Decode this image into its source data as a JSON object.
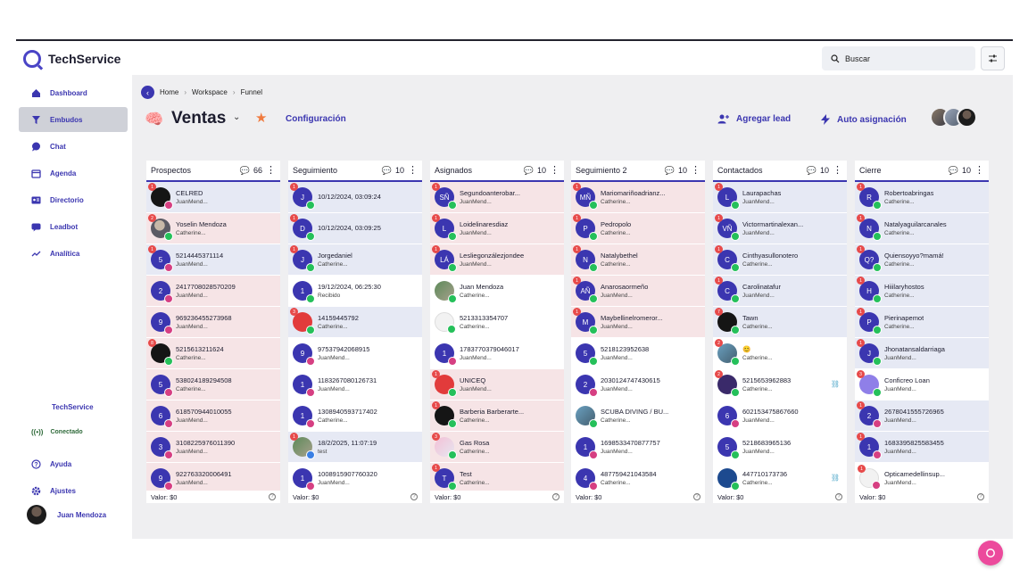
{
  "app": {
    "name": "TechService"
  },
  "search": {
    "placeholder": "Buscar"
  },
  "sidebar": {
    "items": [
      {
        "label": "Dashboard",
        "icon": "home-icon"
      },
      {
        "label": "Embudos",
        "icon": "funnel-icon",
        "active": true
      },
      {
        "label": "Chat",
        "icon": "chat-icon"
      },
      {
        "label": "Agenda",
        "icon": "calendar-icon"
      },
      {
        "label": "Directorio",
        "icon": "contacts-icon"
      },
      {
        "label": "Leadbot",
        "icon": "bot-icon"
      },
      {
        "label": "Analítica",
        "icon": "trend-icon"
      }
    ],
    "brand": "TechService",
    "status": "Conectado",
    "help": "Ayuda",
    "settings": "Ajustes",
    "user": "Juan Mendoza"
  },
  "breadcrumb": [
    "Home",
    "Workspace",
    "Funnel"
  ],
  "header": {
    "title": "Ventas",
    "config": "Configuración",
    "add_lead": "Agregar lead",
    "auto_assign": "Auto asignación"
  },
  "colors": {
    "accent": "#3b36b0",
    "star": "#f07a3e",
    "fab": "#ec4a9c"
  },
  "columns": [
    {
      "title": "Prospectos",
      "count": "66",
      "footer": "Valor:  $0",
      "cards": [
        {
          "name": "CELRED",
          "sub": "JuanMend...",
          "av": "",
          "avc": "black",
          "badge": "1",
          "chan": "ig",
          "bg": "blue"
        },
        {
          "name": "Yoselin Mendoza",
          "sub": "Catherine...",
          "av": "",
          "avc": "photo",
          "badge": "2",
          "chan": "wa",
          "bg": "red"
        },
        {
          "name": "5214445371114",
          "sub": "JuanMend...",
          "av": "5",
          "avc": "",
          "badge": "1",
          "chan": "ig",
          "bg": "blue"
        },
        {
          "name": "2417708028570209",
          "sub": "JuanMend...",
          "av": "2",
          "avc": "",
          "badge": "",
          "chan": "ig",
          "bg": "red"
        },
        {
          "name": "969236455273968",
          "sub": "JuanMend...",
          "av": "9",
          "avc": "",
          "badge": "",
          "chan": "ig",
          "bg": "red"
        },
        {
          "name": "5215613211624",
          "sub": "Catherine...",
          "av": "",
          "avc": "black",
          "badge": "8",
          "chan": "wa",
          "bg": "red"
        },
        {
          "name": "538024189294508",
          "sub": "Catherine...",
          "av": "5",
          "avc": "",
          "badge": "",
          "chan": "ig",
          "bg": "red"
        },
        {
          "name": "618570944010055",
          "sub": "JuanMend...",
          "av": "6",
          "avc": "",
          "badge": "",
          "chan": "ig",
          "bg": "red"
        },
        {
          "name": "3108225976011390",
          "sub": "JuanMend...",
          "av": "3",
          "avc": "",
          "badge": "",
          "chan": "ig",
          "bg": "red"
        },
        {
          "name": "922763320006491",
          "sub": "JuanMend...",
          "av": "9",
          "avc": "",
          "badge": "",
          "chan": "ig",
          "bg": "red"
        }
      ]
    },
    {
      "title": "Seguimiento",
      "count": "10",
      "footer": "Valor:  $0",
      "cards": [
        {
          "name": "10/12/2024, 03:09:24",
          "sub": "",
          "av": "J",
          "avc": "",
          "badge": "1",
          "chan": "wa",
          "bg": "blue"
        },
        {
          "name": "10/12/2024, 03:09:25",
          "sub": "",
          "av": "D",
          "avc": "",
          "badge": "1",
          "chan": "wa",
          "bg": "blue"
        },
        {
          "name": "Jorgedaniel",
          "sub": "Catherine...",
          "av": "J",
          "avc": "",
          "badge": "1",
          "chan": "wa",
          "bg": "blue"
        },
        {
          "name": "19/12/2024, 06:25:30",
          "sub": "Recibido",
          "av": "1",
          "avc": "",
          "badge": "",
          "chan": "wa",
          "bg": "white"
        },
        {
          "name": "14159445792",
          "sub": "Catherine...",
          "av": "",
          "avc": "red",
          "badge": "3",
          "chan": "wa",
          "bg": "blue"
        },
        {
          "name": "97537942068915",
          "sub": "JuanMend...",
          "av": "9",
          "avc": "",
          "badge": "",
          "chan": "ig",
          "bg": "white"
        },
        {
          "name": "1183267080126731",
          "sub": "JuanMend...",
          "av": "1",
          "avc": "",
          "badge": "",
          "chan": "ig",
          "bg": "white"
        },
        {
          "name": "1308940593717402",
          "sub": "Catherine...",
          "av": "1",
          "avc": "",
          "badge": "",
          "chan": "ig",
          "bg": "white"
        },
        {
          "name": "18/2/2025, 11:07:19",
          "sub": "test",
          "av": "",
          "avc": "photo2",
          "badge": "1",
          "chan": "ms",
          "bg": "blue"
        },
        {
          "name": "1008915907760320",
          "sub": "JuanMend...",
          "av": "1",
          "avc": "",
          "badge": "",
          "chan": "ig",
          "bg": "white"
        }
      ]
    },
    {
      "title": "Asignados",
      "count": "10",
      "footer": "Valor:  $0",
      "cards": [
        {
          "name": "Segundoanterobar...",
          "sub": "JuanMend...",
          "av": "SÑ",
          "avc": "",
          "badge": "1",
          "chan": "wa",
          "bg": "red"
        },
        {
          "name": "Loidelinaresdiaz",
          "sub": "JuanMend...",
          "av": "L",
          "avc": "",
          "badge": "1",
          "chan": "wa",
          "bg": "red"
        },
        {
          "name": "Lesliegonzálezjondee",
          "sub": "JuanMend...",
          "av": "LÁ",
          "avc": "",
          "badge": "1",
          "chan": "wa",
          "bg": "red"
        },
        {
          "name": "Juan Mendoza",
          "sub": "Catherine...",
          "av": "",
          "avc": "photo2",
          "badge": "",
          "chan": "wa",
          "bg": "white"
        },
        {
          "name": "5213313354707",
          "sub": "Catherine...",
          "av": "",
          "avc": "white",
          "badge": "",
          "chan": "wa",
          "bg": "white"
        },
        {
          "name": "1783770379046017",
          "sub": "JuanMend...",
          "av": "1",
          "avc": "",
          "badge": "",
          "chan": "ig",
          "bg": "white"
        },
        {
          "name": "UNICEQ",
          "sub": "JuanMend...",
          "av": "",
          "avc": "red",
          "badge": "1",
          "chan": "wa",
          "bg": "red"
        },
        {
          "name": "Barberia Barberarte...",
          "sub": "Catherine...",
          "av": "",
          "avc": "black",
          "badge": "1",
          "chan": "wa",
          "bg": "red"
        },
        {
          "name": "Gas Rosa",
          "sub": "Catherine...",
          "av": "",
          "avc": "photo4",
          "badge": "3",
          "chan": "wa",
          "bg": "red"
        },
        {
          "name": "Test",
          "sub": "Catherine...",
          "av": "T",
          "avc": "",
          "badge": "1",
          "chan": "wa",
          "bg": "red"
        }
      ]
    },
    {
      "title": "Seguimiento 2",
      "count": "10",
      "footer": "Valor:  $0",
      "cards": [
        {
          "name": "Mariomariñoadrianz...",
          "sub": "Catherine...",
          "av": "MÑ",
          "avc": "",
          "badge": "1",
          "chan": "wa",
          "bg": "red"
        },
        {
          "name": "Pedropolo",
          "sub": "Catherine...",
          "av": "P",
          "avc": "",
          "badge": "1",
          "chan": "wa",
          "bg": "red"
        },
        {
          "name": "Natalybethel",
          "sub": "Catherine...",
          "av": "N",
          "avc": "",
          "badge": "1",
          "chan": "wa",
          "bg": "red"
        },
        {
          "name": "Anarosaormeño",
          "sub": "JuanMend...",
          "av": "AÑ",
          "avc": "",
          "badge": "1",
          "chan": "wa",
          "bg": "red"
        },
        {
          "name": "Maybellinelromeror...",
          "sub": "JuanMend...",
          "av": "M",
          "avc": "",
          "badge": "1",
          "chan": "wa",
          "bg": "red"
        },
        {
          "name": "5218123952638",
          "sub": "JuanMend...",
          "av": "5",
          "avc": "",
          "badge": "",
          "chan": "wa",
          "bg": "white"
        },
        {
          "name": "2030124747430615",
          "sub": "JuanMend...",
          "av": "2",
          "avc": "",
          "badge": "",
          "chan": "ig",
          "bg": "white"
        },
        {
          "name": "SCUBA DIVING / BU...",
          "sub": "Catherine...",
          "av": "",
          "avc": "photo3",
          "badge": "",
          "chan": "wa",
          "bg": "white"
        },
        {
          "name": "1698533470877757",
          "sub": "JuanMend...",
          "av": "1",
          "avc": "",
          "badge": "",
          "chan": "ig",
          "bg": "white"
        },
        {
          "name": "487759421043584",
          "sub": "Catherine...",
          "av": "4",
          "avc": "",
          "badge": "",
          "chan": "ig",
          "bg": "white"
        }
      ]
    },
    {
      "title": "Contactados",
      "count": "10",
      "footer": "Valor:  $0",
      "cards": [
        {
          "name": "Laurapachas",
          "sub": "JuanMend...",
          "av": "L",
          "avc": "",
          "badge": "1",
          "chan": "wa",
          "bg": "blue"
        },
        {
          "name": "Victormartinalexan...",
          "sub": "JuanMend...",
          "av": "VÑ",
          "avc": "",
          "badge": "1",
          "chan": "wa",
          "bg": "blue"
        },
        {
          "name": "Cinthyasullonotero",
          "sub": "Catherine...",
          "av": "C",
          "avc": "",
          "badge": "1",
          "chan": "wa",
          "bg": "blue"
        },
        {
          "name": "Carolinatafur",
          "sub": "JuanMend...",
          "av": "C",
          "avc": "",
          "badge": "1",
          "chan": "wa",
          "bg": "blue"
        },
        {
          "name": "Tawn",
          "sub": "Catherine...",
          "av": "",
          "avc": "black",
          "badge": "7",
          "chan": "wa",
          "bg": "blue"
        },
        {
          "name": "😊",
          "sub": "Catherine...",
          "av": "",
          "avc": "photo3",
          "badge": "2",
          "chan": "wa",
          "bg": "white"
        },
        {
          "name": "5215653962883",
          "sub": "Catherine...",
          "av": "",
          "avc": "cash",
          "badge": "2",
          "chan": "wa",
          "bg": "white",
          "tag": "⛓"
        },
        {
          "name": "602153475867660",
          "sub": "JuanMend...",
          "av": "6",
          "avc": "",
          "badge": "",
          "chan": "ig",
          "bg": "white"
        },
        {
          "name": "5218683965136",
          "sub": "JuanMend...",
          "av": "5",
          "avc": "",
          "badge": "",
          "chan": "wa",
          "bg": "white"
        },
        {
          "name": "447710173736",
          "sub": "Catherine...",
          "av": "",
          "avc": "fb",
          "badge": "",
          "chan": "wa",
          "bg": "white",
          "tag": "⛓"
        }
      ]
    },
    {
      "title": "Cierre",
      "count": "10",
      "footer": "Valor:  $0",
      "cards": [
        {
          "name": "Robertoabringas",
          "sub": "Catherine...",
          "av": "R",
          "avc": "",
          "badge": "1",
          "chan": "wa",
          "bg": "blue"
        },
        {
          "name": "Natalyaguilarcanales",
          "sub": "Catherine...",
          "av": "N",
          "avc": "",
          "badge": "1",
          "chan": "wa",
          "bg": "blue"
        },
        {
          "name": "Quiensoyyo?mamá!",
          "sub": "Catherine...",
          "av": "Q?",
          "avc": "",
          "badge": "1",
          "chan": "wa",
          "bg": "blue"
        },
        {
          "name": "Hiiilaryhostos",
          "sub": "Catherine...",
          "av": "H",
          "avc": "",
          "badge": "1",
          "chan": "wa",
          "bg": "blue"
        },
        {
          "name": "Pierinapemot",
          "sub": "Catherine...",
          "av": "P",
          "avc": "",
          "badge": "1",
          "chan": "wa",
          "bg": "blue"
        },
        {
          "name": "Jhonatansaldarriaga",
          "sub": "JuanMend...",
          "av": "J",
          "avc": "",
          "badge": "1",
          "chan": "wa",
          "bg": "blue"
        },
        {
          "name": "Conficreo Loan",
          "sub": "JuanMend...",
          "av": "",
          "avc": "violet",
          "badge": "3",
          "chan": "wa",
          "bg": "white"
        },
        {
          "name": "2678041555726965",
          "sub": "JuanMend...",
          "av": "2",
          "avc": "",
          "badge": "1",
          "chan": "ig",
          "bg": "blue"
        },
        {
          "name": "1683395825583455",
          "sub": "JuanMend...",
          "av": "1",
          "avc": "",
          "badge": "1",
          "chan": "ig",
          "bg": "blue"
        },
        {
          "name": "Opticamedellinsup...",
          "sub": "JuanMend...",
          "av": "",
          "avc": "white",
          "badge": "1",
          "chan": "ig",
          "bg": "white"
        }
      ]
    }
  ]
}
